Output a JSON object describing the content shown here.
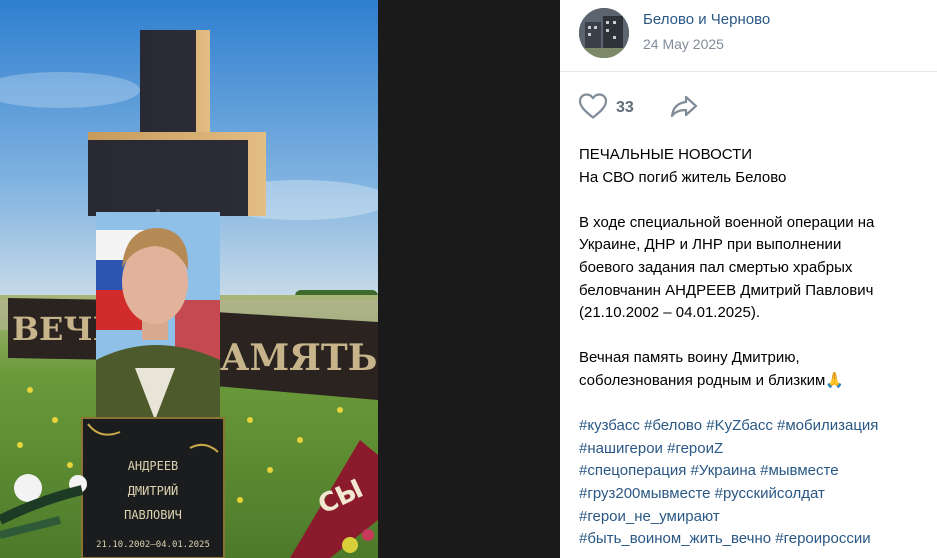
{
  "post": {
    "group_name": "Белово и Черново",
    "date": "24 May 2025",
    "likes": "33",
    "title_lines": [
      "ПЕЧАЛЬНЫЕ НОВОСТИ",
      "На СВО погиб житель Белово"
    ],
    "body_lines": [
      "В ходе специальной военной операции на",
      "Украине, ДНР и ЛНР при выполнении",
      "боевого задания пал смертью храбрых",
      "беловчанин АНДРЕЕВ Дмитрий Павлович",
      "(21.10.2002 – 04.01.2025)."
    ],
    "closing_lines": [
      "Вечная память воину Дмитрию,",
      "соболезнования родным и близким🙏"
    ],
    "hashtag_lines": [
      [
        "#кузбасс",
        "#белово",
        "#KyZбасс",
        "#мобилизация"
      ],
      [
        "#нашигерои",
        "#героиZ"
      ],
      [
        "#спецоперация",
        "#Украина",
        "#мывместе"
      ],
      [
        "#груз200мывместе",
        "#русскийсолдат"
      ],
      [
        "#герои_не_умирают"
      ],
      [
        "#быть_воином_жить_вечно",
        "#героироссии"
      ]
    ]
  },
  "photo": {
    "plaque_lines": [
      "АНДРЕЕВ",
      "ДМИТРИЙ",
      "ПАВЛОВИЧ",
      "21.10.2002–04.01.2025"
    ],
    "banner_left": "ВЕЧНА",
    "banner_right": "АМЯТЬ",
    "ribbon_text": "СЫ"
  },
  "icons": {
    "like": "heart-icon",
    "share": "share-arrow-icon"
  },
  "colors": {
    "link": "#2a5885",
    "muted": "#818c99",
    "counter": "#626d7a"
  }
}
